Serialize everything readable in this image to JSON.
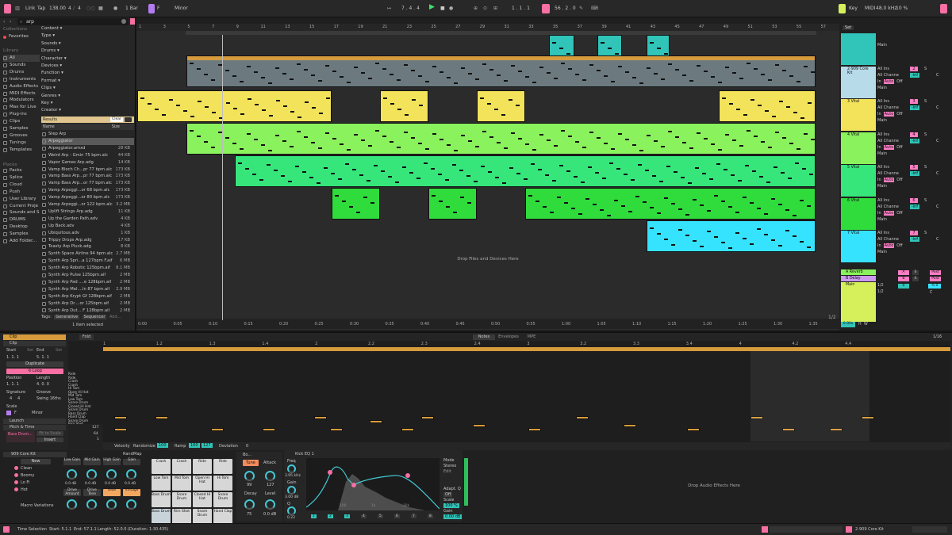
{
  "colors": {
    "accent": "#f76fa3",
    "orange": "#d69b3c",
    "lime": "#8af25c",
    "green": "#37e67b",
    "cyan": "#31c4b8",
    "yellow": "#f2e35b",
    "teal": "#1fd3c1",
    "sky": "#36e3ff",
    "pink": "#ff7dc4",
    "lightblue": "#b7dbe8",
    "yellowgreen": "#d6f05c"
  },
  "topbar": {
    "link": "Link",
    "tap": "Tap",
    "bpm": "138.00",
    "time_sig_num": "4",
    "time_sig_den": "4",
    "metronome": "○○",
    "quantize": "1 Bar",
    "key": "F",
    "scale": "Minor",
    "position": "7 .  4 .  4",
    "loop_start": "1 .  1 .  1",
    "loop_length": "56 .  2 .  0",
    "key_label": "Key",
    "midi_label": "MIDI",
    "sample_rate": "48.0 kHz",
    "cpu": "10 %"
  },
  "browser": {
    "search_value": "arp",
    "collections_head": "Collections",
    "favorites": "Favorites",
    "library_head": "Library",
    "library_items": [
      "All",
      "Sounds",
      "Drums",
      "Instruments",
      "Audio Effects",
      "MIDI Effects",
      "Modulators",
      "Max for Live",
      "Plug-ins",
      "Clips",
      "Samples",
      "Grooves",
      "Tunings",
      "Templates"
    ],
    "places_head": "Places",
    "places_items": [
      "Packs",
      "Splice",
      "Cloud",
      "Push",
      "User Library",
      "Current Proje",
      "Sounds and S",
      "DRUMS",
      "Desktop",
      "Samples",
      "Add Folder..."
    ],
    "filters": [
      "Content ▾",
      "Type ▾",
      "Sounds ▾",
      "Drums ▾",
      "Character ▾",
      "Devices ▾",
      "Function ▾",
      "Format ▾",
      "Clips ▾",
      "Genres ▾",
      "Key ▾",
      "Creator ▾"
    ],
    "results_label": "Results",
    "clear_label": "Clear",
    "name_col": "Name",
    "size_col": "Size",
    "files": [
      {
        "name": "Step Arp",
        "size": ""
      },
      {
        "name": "Arpeggiator",
        "size": ""
      },
      {
        "name": "Arpeggiator.amxd",
        "size": "28 KB"
      },
      {
        "name": "Weird Arp - Gmin 75 bpm.alc",
        "size": "44 KB"
      },
      {
        "name": "Vapor Games Arp.adg",
        "size": "14 KB"
      },
      {
        "name": "Vamp Bloch Ch...pr 77 bpm.alc",
        "size": "173 KB"
      },
      {
        "name": "Vamp Bass Arp...pr 77 bpm.alc",
        "size": "173 KB"
      },
      {
        "name": "Vamp Bass Arp...or 77 bpm.alc",
        "size": "173 KB"
      },
      {
        "name": "Vamp Arpeggi...or 68 bpm.alc",
        "size": "173 KB"
      },
      {
        "name": "Vamp Arpeggi...or 80 bpm.alc",
        "size": "173 KB"
      },
      {
        "name": "Vamp Arpeggi...or 122 bpm.alc",
        "size": "3.2 MB"
      },
      {
        "name": "Uplift Strings Arp.adg",
        "size": "11 KB"
      },
      {
        "name": "Up the Garden Path.adv",
        "size": "4 KB"
      },
      {
        "name": "Up Back.adv",
        "size": "4 KB"
      },
      {
        "name": "Ubiquitous.adv",
        "size": "1 KB"
      },
      {
        "name": "Trippy Drops Arp.adg",
        "size": "17 KB"
      },
      {
        "name": "Toasty Arp Pluck.adg",
        "size": "8 KB"
      },
      {
        "name": "Synth Space Airline 94 bpm.alc",
        "size": "2.7 MB"
      },
      {
        "name": "Synth Arp Spri...a 127bpm F.aif",
        "size": "6 MB"
      },
      {
        "name": "Synth Arp Robotic 125bpm.aif",
        "size": "8.1 MB"
      },
      {
        "name": "Synth Arp Pulse 125bpm.aif",
        "size": "2 MB"
      },
      {
        "name": "Synth Arp Pad ....e 128bpm.aif",
        "size": "2 MB"
      },
      {
        "name": "Synth Arp Mel....In 87 bpm.aif",
        "size": "2.9 MB"
      },
      {
        "name": "Synth Arp Krypt Gf 128bpm.aif",
        "size": "2 MB"
      },
      {
        "name": "Synth Arp Dr....or 125bpm.aif",
        "size": "2 MB"
      },
      {
        "name": "Synth Arp Dut... F 128bpm.aif",
        "size": "2 MB"
      }
    ],
    "tags_label": "Tags:",
    "tag1": "Generative",
    "tag2": "Sequencer",
    "tag3": "Add...",
    "selected_info": "1 item selected"
  },
  "arrangement": {
    "bar_numbers": [
      "1",
      "3",
      "5",
      "7",
      "9",
      "11",
      "13",
      "15",
      "17",
      "19",
      "21",
      "23",
      "25",
      "27",
      "29",
      "31",
      "33",
      "35",
      "37",
      "39",
      "41",
      "43",
      "45",
      "47",
      "49",
      "51",
      "53",
      "55",
      "57"
    ],
    "time_labels": [
      "0:00",
      "0:05",
      "0:10",
      "0:15",
      "0:20",
      "0:25",
      "0:30",
      "0:35",
      "0:40",
      "0:45",
      "0:50",
      "0:55",
      "1:00",
      "1:05",
      "1:10",
      "1:15",
      "1:20",
      "1:25",
      "1:30",
      "1:35"
    ],
    "drop_hint": "Drop Files and Devices Here",
    "page": "1/2",
    "set_label": "Set"
  },
  "mixer": {
    "tracks": [
      {
        "name": "",
        "input": "",
        "out": "Main",
        "num": ""
      },
      {
        "name": "2-909 Core Kit",
        "input": "All Ins",
        "out": "Main",
        "num": "2"
      },
      {
        "name": "3 Vital",
        "input": "All Ins",
        "out": "Main",
        "num": "3"
      },
      {
        "name": "4 Vital",
        "input": "All Ins",
        "out": "Main",
        "num": "4"
      },
      {
        "name": "5 Vital",
        "input": "All Ins",
        "out": "Main",
        "num": "5"
      },
      {
        "name": "6 Vital",
        "input": "All Ins",
        "out": "Main",
        "num": "6"
      },
      {
        "name": "7 Vital",
        "input": "All Ins",
        "out": "Main",
        "num": "7"
      }
    ],
    "returns": [
      {
        "name": "A Reverb",
        "num": "A"
      },
      {
        "name": "B Delay",
        "num": "B"
      }
    ],
    "main": "Main",
    "channel_label": "All Channe",
    "auto_label": "Auto",
    "off_label": "Off",
    "in_label": "In",
    "solo": "S",
    "center": "C",
    "vol_m1": "-inf",
    "tempo_readout": "0.00s",
    "h": "H",
    "w": "W",
    "main_vol": "-6.0",
    "main_num": "0",
    "main_sel": "1/2",
    "post": "Post"
  },
  "clip_panel": {
    "title": "Clip",
    "clip_label": "Clip",
    "start": "Start",
    "set": "Set",
    "end": "End",
    "start_val": "1.  1.  1",
    "end_val": "5.  1.  1",
    "duplicate": "Duplicate",
    "loop": "Loop",
    "position": "Position",
    "length": "Length",
    "pos_val": "1.  1.  1",
    "len_val": "4.  0.  0",
    "signature": "Signature",
    "groove": "Groove",
    "sig_num": "4",
    "sig_den": "4",
    "groove_val": "Swing 16ths",
    "scale": "Scale",
    "scale_key": "F",
    "scale_mode": "Minor",
    "launch": "Launch",
    "pitch_time": "Pitch & Time",
    "fit_scale": "Fit to Scale",
    "sample_name": "Bass Drum...",
    "insert": "Insert",
    "fold": "Fold",
    "tabs": [
      "Notes",
      "Envelopes",
      "MPE"
    ],
    "page": "1/16"
  },
  "piano_roll": {
    "bar_labels": [
      "1",
      "1.2",
      "1.3",
      "1.4",
      "2",
      "2.2",
      "2.3",
      "2.4",
      "3",
      "3.2",
      "3.3",
      "3.4",
      "4",
      "4.2",
      "4.4"
    ],
    "lanes": [
      "Ride",
      "Ride",
      "Crash",
      "Crash",
      "Hi Tom",
      "Open Hi Hat",
      "Mid Tom",
      "Low Tom",
      "Snare Drum",
      "Closed Hi Hat",
      "Snare Drum",
      "Bass Drum",
      "Hand Clap",
      "Snare Drum",
      "Rim Shot",
      "Bass Drum"
    ],
    "vel_top": "127",
    "vel_mid": "64",
    "vel_bot": "1",
    "velocity_label": "Velocity",
    "randomize": "Randomize",
    "randomize_val": "100",
    "ramp": "Ramp",
    "ramp_a": "100",
    "ramp_b": "127",
    "deviation": "Deviation",
    "dev_val": "0"
  },
  "devices": {
    "kit_name": "909 Core Kit",
    "new_label": "New",
    "variations": [
      "Clean",
      "Boomy",
      "Lo Fi",
      "Hot"
    ],
    "macro_variations": "Macro Variations",
    "macros": [
      {
        "name": "Low Gain",
        "val": "0.0 dB"
      },
      {
        "name": "Mid Gain",
        "val": "0.0 dB"
      },
      {
        "name": "High Gain",
        "val": "0.0 dB"
      },
      {
        "name": "Gain",
        "val": "0.0 dB"
      }
    ],
    "macro_buttons": [
      "Drive Amount",
      "Drive Tone",
      "Glue",
      "Vintage"
    ],
    "pads": [
      "Crash",
      "Crash",
      "Ride",
      "Ride",
      "Low Tom",
      "Mid Tom",
      "Open Hi Hat",
      "Hi Tom",
      "Bass Drum",
      "Snare Drum",
      "Closed Hi Hat",
      "Snare Drum",
      "Bass Drum",
      "Rim Shot",
      "Snare Drum",
      "Hand Clap"
    ],
    "rand": "Rand",
    "map": "Map",
    "drum_rack_label": "Bo...",
    "tune": "Tune",
    "attack": "Attack",
    "tune_val": "99",
    "attack_val": "127",
    "decay": "Decay",
    "level": "Level",
    "decay_val": "75",
    "level_val": "0.0 dB",
    "eq_title": "Kick EQ 1",
    "freq": "Freq",
    "freq_val": "3.95 kHz",
    "gain": "Gain",
    "gain_val": "3.00 dB",
    "q": "Q",
    "q_val": "0.22",
    "mode": "Mode",
    "stereo": "Stereo",
    "edit": "Edit",
    "adapt_q": "Adapt. Q",
    "adapt_val": "Off",
    "scale": "Scale",
    "scale_val": "100 %",
    "out_gain": "Gain",
    "out_gain_val": "0.00 dB",
    "eq_bands": [
      "1",
      "2",
      "3",
      "4",
      "5",
      "6",
      "7",
      "8"
    ],
    "eq_freqs": [
      "100",
      "1k",
      "10k"
    ],
    "drop_effects": "Drop Audio Effects Here"
  },
  "status": {
    "time_selection": "Time Selection",
    "start": "Start: 5.1.1",
    "end": "End: 57.1.1",
    "length": "Length: 52.0.0 (Duration: 1:30.435)",
    "track_name": "2-909 Core Kit"
  }
}
